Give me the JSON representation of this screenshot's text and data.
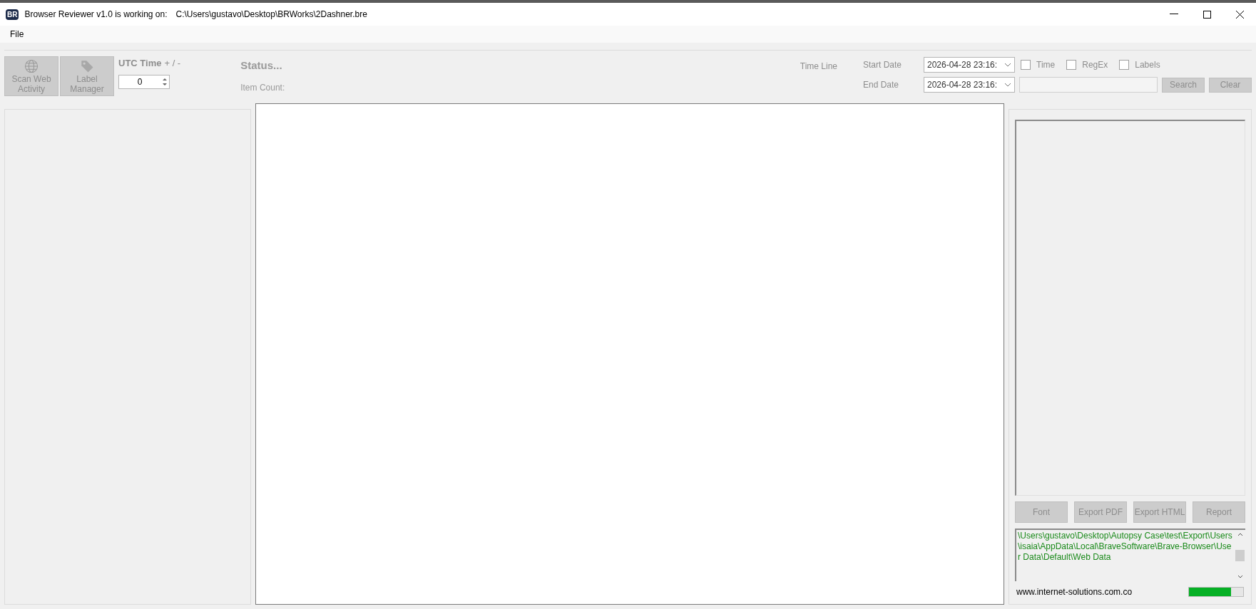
{
  "window": {
    "app_icon": "BR",
    "title": "Browser Reviewer v1.0 is working on:",
    "file_path": "C:\\Users\\gustavo\\Desktop\\BRWorks\\2Dashner.bre"
  },
  "menu": [
    "File"
  ],
  "toolbar": {
    "buttons": [
      {
        "kind": "globe",
        "label": "Scan Web Activity",
        "disabled": true
      },
      {
        "kind": "tag",
        "label": "Label Manager",
        "disabled": true
      }
    ],
    "utc_label": "UTC Time",
    "utc_suffix": "+ / -",
    "utc_value": "0",
    "status": "Status...",
    "item_count": "Item Count:"
  },
  "filter": {
    "timeline_label": "Time Line",
    "start_label": "Start Date",
    "start_value": "2026-04-28 23:16:",
    "end_label": "End Date",
    "end_value": "2026-04-28 23:16:",
    "checkboxes": [
      {
        "label": "Time",
        "checked": false
      },
      {
        "label": "RegEx",
        "checked": false
      },
      {
        "label": "Labels",
        "checked": false
      }
    ],
    "buttons": [
      {
        "label": "Search",
        "disabled": true
      },
      {
        "label": "Clear",
        "disabled": true
      }
    ]
  },
  "right_panel": {
    "buttons": [
      {
        "label": "Font",
        "disabled": true
      },
      {
        "label": "Export PDF",
        "disabled": true
      },
      {
        "label": "Export HTML",
        "disabled": true
      },
      {
        "label": "Report",
        "disabled": true
      }
    ],
    "log": "\\Users\\gustavo\\Desktop\\Autopsy Case\\test\\Export\\Users\\isaia\\AppData\\Local\\BraveSoftware\\Brave-Browser\\User Data\\Default\\Web Data",
    "website": "www.internet-solutions.com.co",
    "progress": {
      "level": 0.78
    }
  }
}
